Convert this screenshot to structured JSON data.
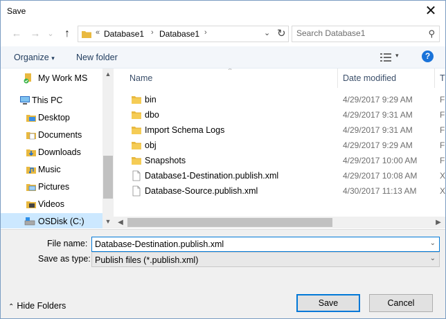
{
  "window": {
    "title": "Save",
    "close_glyph": "✕"
  },
  "nav": {
    "back_glyph": "←",
    "forward_glyph": "→",
    "recent_glyph": "⌄",
    "up_glyph": "↑"
  },
  "address": {
    "overflow_glyph": "«",
    "segments": [
      "Database1",
      "Database1"
    ],
    "separator_glyph": "›",
    "dropdown_glyph": "⌄",
    "refresh_glyph": "↻"
  },
  "search": {
    "placeholder": "Search Database1",
    "icon_glyph": "⚲"
  },
  "commandbar": {
    "organize_label": "Organize",
    "organize_arrow": "▾",
    "new_folder_label": "New folder",
    "view_arrow": "▾",
    "help_glyph": "?"
  },
  "sidebar": {
    "items": [
      {
        "label": "My Work MS",
        "icon": "onedrive-icon"
      },
      {
        "label": "This PC",
        "icon": "computer-icon"
      },
      {
        "label": "Desktop",
        "icon": "desktop-folder-icon"
      },
      {
        "label": "Documents",
        "icon": "documents-folder-icon"
      },
      {
        "label": "Downloads",
        "icon": "downloads-folder-icon"
      },
      {
        "label": "Music",
        "icon": "music-folder-icon"
      },
      {
        "label": "Pictures",
        "icon": "pictures-folder-icon"
      },
      {
        "label": "Videos",
        "icon": "videos-folder-icon"
      },
      {
        "label": "OSDisk (C:)",
        "icon": "drive-icon"
      }
    ],
    "scroll_up_glyph": "▲",
    "scroll_down_glyph": "▼"
  },
  "filelist": {
    "columns": {
      "name": "Name",
      "date": "Date modified",
      "type": "T"
    },
    "sort_glyph": "^",
    "rows": [
      {
        "name": "bin",
        "date": "4/29/2017 9:29 AM",
        "type": "F",
        "kind": "folder"
      },
      {
        "name": "dbo",
        "date": "4/29/2017 9:31 AM",
        "type": "F",
        "kind": "folder"
      },
      {
        "name": "Import Schema Logs",
        "date": "4/29/2017 9:31 AM",
        "type": "F",
        "kind": "folder"
      },
      {
        "name": "obj",
        "date": "4/29/2017 9:29 AM",
        "type": "F",
        "kind": "folder"
      },
      {
        "name": "Snapshots",
        "date": "4/29/2017 10:00 AM",
        "type": "F",
        "kind": "folder"
      },
      {
        "name": "Database1-Destination.publish.xml",
        "date": "4/29/2017 10:08 AM",
        "type": "X",
        "kind": "file"
      },
      {
        "name": "Database-Source.publish.xml",
        "date": "4/30/2017 11:13 AM",
        "type": "X",
        "kind": "file"
      }
    ],
    "scroll_left_glyph": "◀",
    "scroll_right_glyph": "▶"
  },
  "form": {
    "filename_label": "File name:",
    "filename_value": "Database-Destination.publish.xml",
    "savetype_label": "Save as type:",
    "savetype_value": "Publish files (*.publish.xml)",
    "dropdown_glyph": "⌄"
  },
  "footer": {
    "hide_folders_label": "Hide Folders",
    "hide_folders_glyph": "⌃",
    "save_label": "Save",
    "cancel_label": "Cancel"
  },
  "colors": {
    "folder_yellow": "#e9b940",
    "selection": "#cce8ff",
    "accent": "#0078d7",
    "help_blue": "#1a73d9",
    "command_text": "#1e3a5c"
  }
}
